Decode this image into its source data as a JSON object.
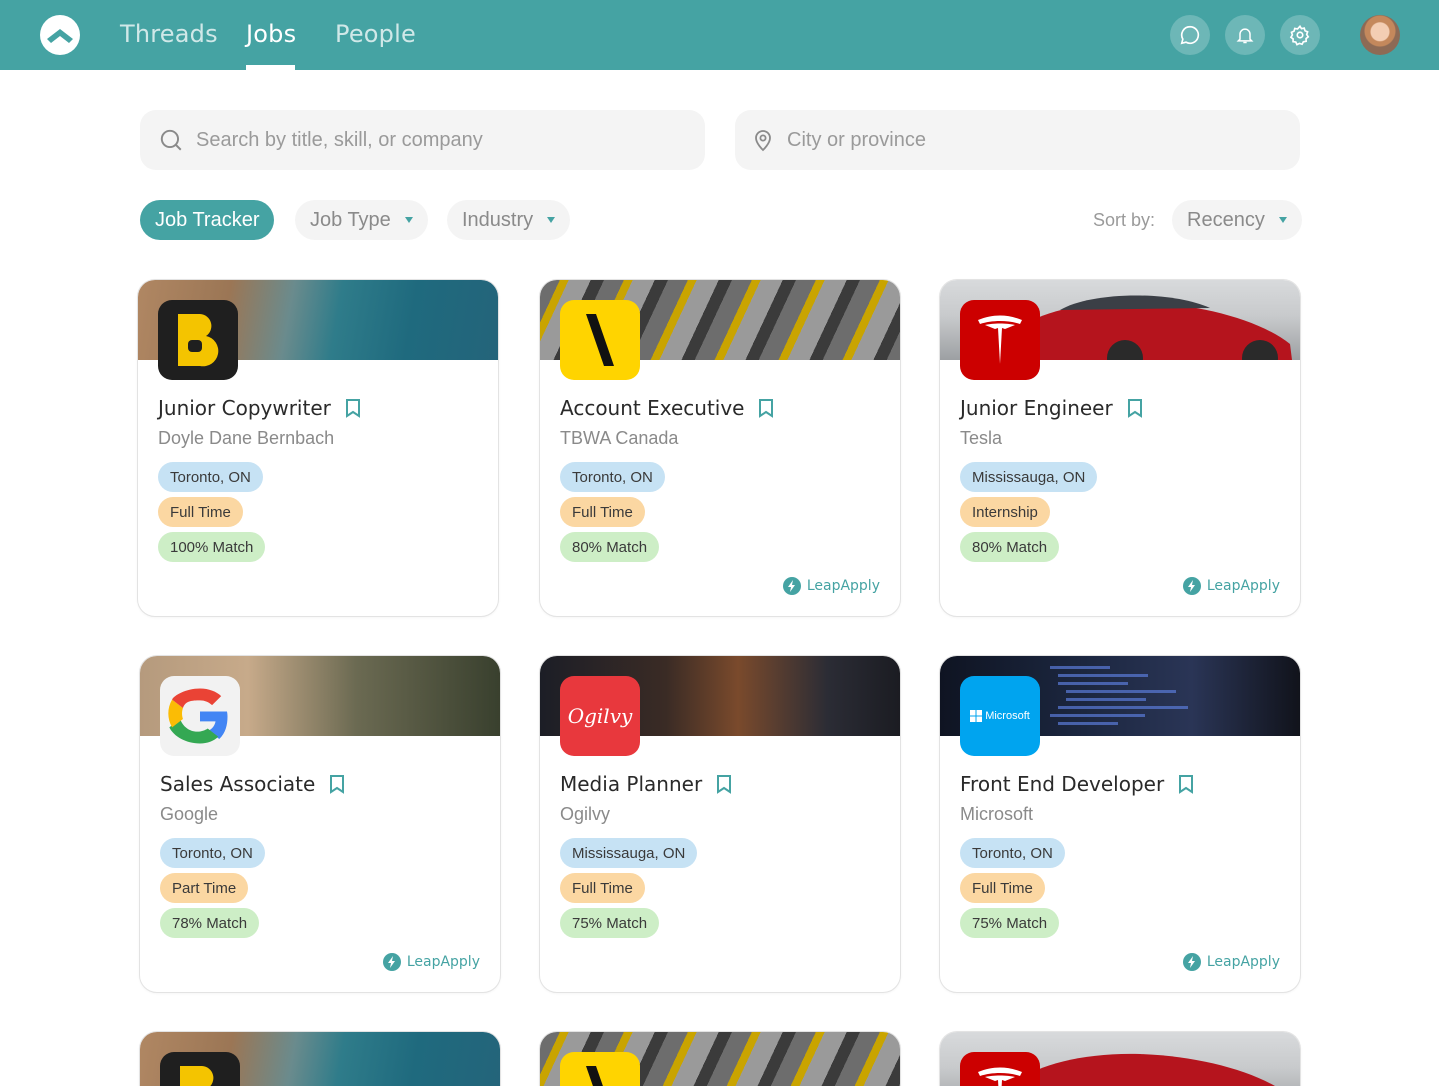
{
  "colors": {
    "brand": "#45a3a3",
    "location_tag": "#c6e2f4",
    "type_tag": "#fbd7a2",
    "match_tag": "#cdeec6"
  },
  "header": {
    "tabs": [
      {
        "label": "Threads",
        "active": false
      },
      {
        "label": "Jobs",
        "active": true
      },
      {
        "label": "People",
        "active": false
      }
    ],
    "icons": [
      "chat-icon",
      "bell-icon",
      "gear-icon"
    ]
  },
  "search": {
    "keyword_placeholder": "Search by title, skill, or company",
    "location_placeholder": "City or province"
  },
  "filters": {
    "job_tracker": "Job Tracker",
    "job_type": "Job Type",
    "industry": "Industry",
    "sort_label": "Sort by:",
    "sort_value": "Recency"
  },
  "jobs": [
    {
      "title": "Junior Copywriter",
      "company": "Doyle Dane Bernbach",
      "location": "Toronto, ON",
      "type": "Full Time",
      "match": "100% Match",
      "leap_apply": ""
    },
    {
      "title": "Account Executive",
      "company": "TBWA Canada",
      "location": "Toronto, ON",
      "type": "Full Time",
      "match": "80% Match",
      "leap_apply": "LeapApply"
    },
    {
      "title": "Junior Engineer",
      "company": "Tesla",
      "location": "Mississauga, ON",
      "type": "Internship",
      "match": "80% Match",
      "leap_apply": "LeapApply"
    },
    {
      "title": "Sales Associate",
      "company": "Google",
      "location": "Toronto, ON",
      "type": "Part Time",
      "match": "78% Match",
      "leap_apply": "LeapApply"
    },
    {
      "title": "Media Planner",
      "company": "Ogilvy",
      "location": "Mississauga, ON",
      "type": "Full Time",
      "match": "75% Match",
      "leap_apply": ""
    },
    {
      "title": "Front End Developer",
      "company": "Microsoft",
      "location": "Toronto, ON",
      "type": "Full Time",
      "match": "75% Match",
      "leap_apply": "LeapApply"
    }
  ],
  "logos": {
    "ogilvy": "Ogilvy",
    "microsoft": "Microsoft"
  }
}
